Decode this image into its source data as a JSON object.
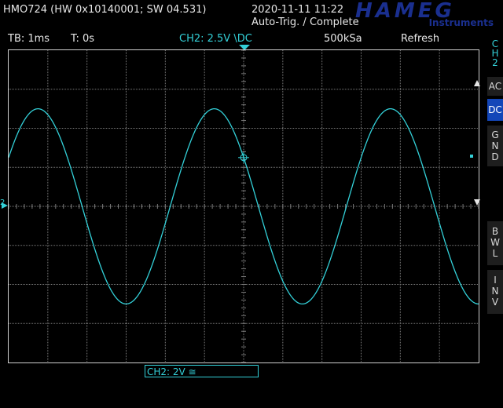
{
  "header": {
    "model": "HMO724 (HW 0x10140001; SW 04.531)",
    "datetime": "2020-11-11 11:22",
    "trigger_status": "Auto-Trig. / Complete",
    "logo_text": "HAMEG",
    "logo_sub": "Instruments"
  },
  "statusbar": {
    "timebase": "TB: 1ms",
    "trigger_time": "T: 0s",
    "trigger_info": "CH2: 2.5V \\DC",
    "sample_rate": "500kSa",
    "mode": "Refresh"
  },
  "side_menu": {
    "channel_label": [
      "C",
      "H",
      "2"
    ],
    "ac": "AC",
    "dc": "DC",
    "gnd": [
      "G",
      "N",
      "D"
    ],
    "bwl": [
      "B",
      "W",
      "L"
    ],
    "inv": [
      "I",
      "N",
      "V"
    ]
  },
  "channel_box": "CH2: 2V ≅",
  "marker_ch": "2",
  "colors": {
    "trace": "#33d0d8",
    "grid": "#7a7a7a",
    "active_button": "#1346b8",
    "logo": "#1a2f8f"
  },
  "waveform": {
    "type": "sine",
    "amplitude_divisions": 2.5,
    "period_divisions": 4.5,
    "phase_at_trigger": "falling-zero-crossing"
  }
}
